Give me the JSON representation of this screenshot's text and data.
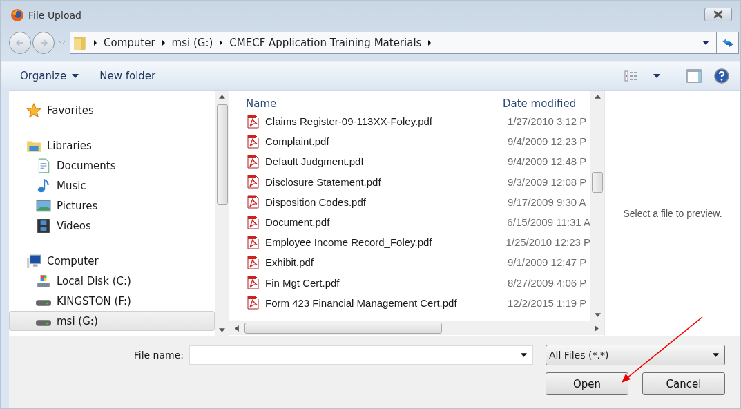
{
  "window": {
    "title": "File Upload"
  },
  "address": {
    "crumbs": [
      "Computer",
      "msi (G:)",
      "CMECF Application Training Materials"
    ]
  },
  "toolbar": {
    "organize": "Organize",
    "new_folder": "New folder"
  },
  "nav": [
    {
      "label": "Favorites",
      "selected": false
    },
    {
      "label": "Libraries",
      "selected": false,
      "children": [
        {
          "label": "Documents",
          "selected": false
        },
        {
          "label": "Music",
          "selected": false
        },
        {
          "label": "Pictures",
          "selected": false
        },
        {
          "label": "Videos",
          "selected": false
        }
      ]
    },
    {
      "label": "Computer",
      "selected": false,
      "children": [
        {
          "label": "Local Disk (C:)",
          "selected": false
        },
        {
          "label": "KINGSTON (F:)",
          "selected": false
        },
        {
          "label": "msi (G:)",
          "selected": true
        }
      ]
    }
  ],
  "columns": [
    "Name",
    "Date modified"
  ],
  "files": [
    {
      "name": "Claims Register-09-113XX-Foley.pdf",
      "date": "1/27/2010 3:12 P"
    },
    {
      "name": "Complaint.pdf",
      "date": "9/4/2009 12:23 P"
    },
    {
      "name": "Default Judgment.pdf",
      "date": "9/4/2009 12:48 P"
    },
    {
      "name": "Disclosure Statement.pdf",
      "date": "9/3/2009 12:08 P"
    },
    {
      "name": "Disposition Codes.pdf",
      "date": "9/17/2009 9:30 A"
    },
    {
      "name": "Document.pdf",
      "date": "6/15/2009 11:31 A"
    },
    {
      "name": "Employee Income Record_Foley.pdf",
      "date": "1/25/2010 12:23 P"
    },
    {
      "name": "Exhibit.pdf",
      "date": "9/1/2009 12:47 P"
    },
    {
      "name": "Fin Mgt Cert.pdf",
      "date": "8/27/2009 4:06 P"
    },
    {
      "name": "Form 423 Financial Management Cert.pdf",
      "date": "12/2/2015 1:19 P"
    }
  ],
  "preview": "Select a file to preview.",
  "file_name": {
    "label": "File name:"
  },
  "filter": {
    "value": "All Files (*.*)"
  },
  "buttons": [
    "Open",
    "Cancel"
  ]
}
